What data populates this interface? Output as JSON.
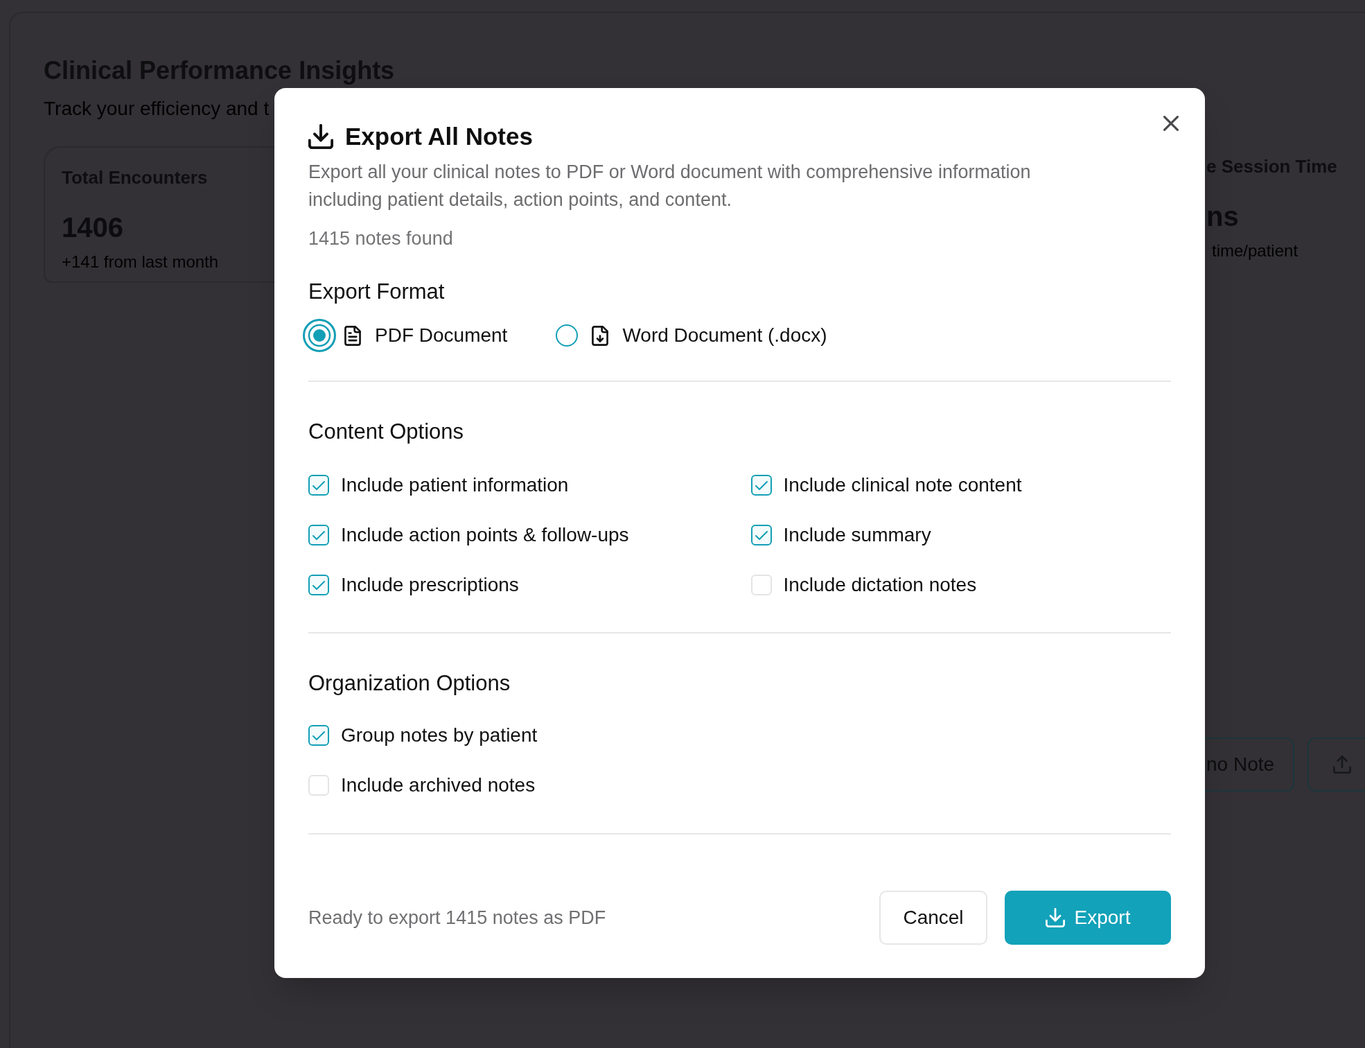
{
  "background_page": {
    "title": "Clinical Performance Insights",
    "subtitle": "Track your efficiency and t",
    "stat_cards": [
      {
        "label": "Total Encounters",
        "value": "1406",
        "change": "+141 from last month"
      },
      {
        "label": "e Session Time",
        "value": "ns",
        "change": "time/patient"
      }
    ],
    "buttons": [
      {
        "kind": "text",
        "label": "no Note"
      },
      {
        "kind": "icon"
      }
    ]
  },
  "dialog": {
    "title": "Export All Notes",
    "description": "Export all your clinical notes to PDF or Word document with comprehensive information including patient details, action points, and content.",
    "count": "1415 notes found",
    "export_format": {
      "heading": "Export Format",
      "options": [
        {
          "kind": "pdf",
          "label": "PDF Document",
          "selected": true
        },
        {
          "kind": "docx",
          "label": "Word Document (.docx)",
          "selected": false
        }
      ]
    },
    "content_options": {
      "heading": "Content Options",
      "options": [
        {
          "label": "Include patient information",
          "checked": true
        },
        {
          "label": "Include clinical note content",
          "checked": true
        },
        {
          "label": "Include action points & follow-ups",
          "checked": true
        },
        {
          "label": "Include summary",
          "checked": true
        },
        {
          "label": "Include prescriptions",
          "checked": true
        },
        {
          "label": "Include dictation notes",
          "checked": false
        }
      ]
    },
    "organization_options": {
      "heading": "Organization Options",
      "options": [
        {
          "label": "Group notes by patient",
          "checked": true
        },
        {
          "label": "Include archived notes",
          "checked": false
        }
      ]
    },
    "footer": {
      "status": "Ready to export 1415 notes as PDF",
      "buttons": [
        {
          "kind": "secondary",
          "label": "Cancel"
        },
        {
          "kind": "primary",
          "label": "Export"
        }
      ]
    }
  }
}
